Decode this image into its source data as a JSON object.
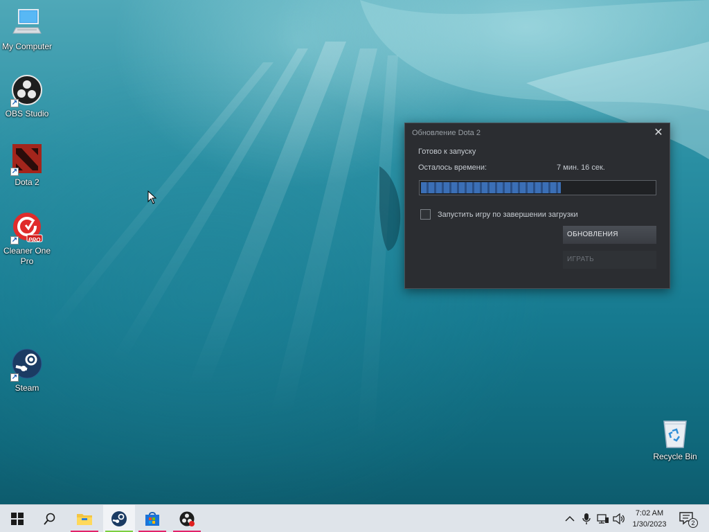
{
  "desktop": {
    "icons": [
      {
        "label": "My Computer",
        "icon": "computer-icon"
      },
      {
        "label": "OBS Studio",
        "icon": "obs-icon"
      },
      {
        "label": "Dota 2",
        "icon": "dota2-icon"
      },
      {
        "label": "Cleaner One Pro",
        "icon": "cleaner-one-icon",
        "badge": "PRO"
      },
      {
        "label": "Steam",
        "icon": "steam-icon"
      },
      {
        "label": "Recycle Bin",
        "icon": "recycle-bin-icon"
      }
    ]
  },
  "dialog": {
    "title": "Обновление Dota 2",
    "status": "Готово к запуску",
    "time_label": "Осталось времени:",
    "time_value": "7 мин. 16 сек.",
    "progress_fraction": 0.6,
    "checkbox_label": "Запустить игру по завершении загрузки",
    "checkbox_checked": false,
    "updates_button": "ОБНОВЛЕНИЯ",
    "play_button": "ИГРАТЬ",
    "close_glyph": "✕"
  },
  "taskbar": {
    "pinned": [
      "start-icon",
      "search-icon",
      "file-explorer-icon",
      "steam-icon",
      "microsoft-store-icon",
      "obs-icon"
    ],
    "tray": [
      "chevron-up-icon",
      "microphone-icon",
      "network-icon",
      "volume-icon"
    ],
    "time": "7:02 AM",
    "date": "1/30/2023",
    "notification_count": "2"
  },
  "colors": {
    "accent_underline": "#e3226a",
    "steam_active_underline": "#7ccf3f",
    "progress_fill": "#3b6fb6"
  }
}
